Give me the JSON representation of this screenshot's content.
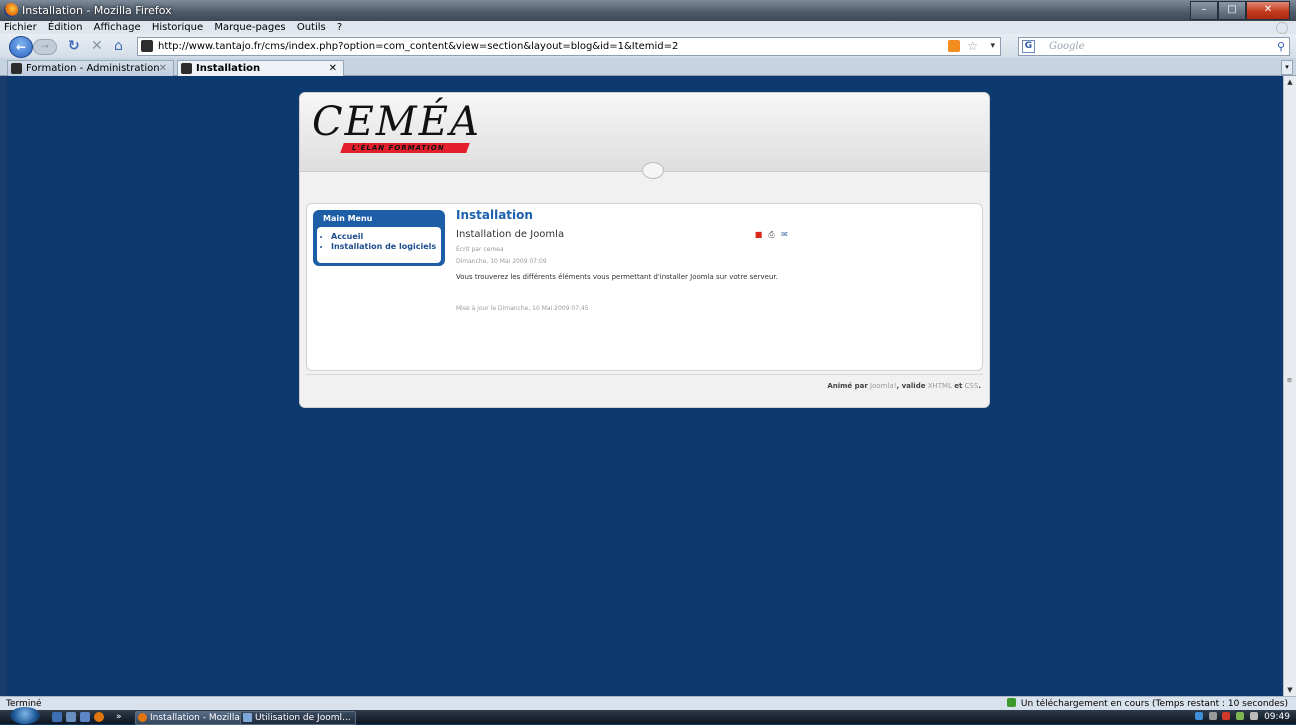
{
  "window": {
    "title": "Installation - Mozilla Firefox"
  },
  "menubar": {
    "items": [
      "Fichier",
      "Édition",
      "Affichage",
      "Historique",
      "Marque-pages",
      "Outils",
      "?"
    ]
  },
  "navbar": {
    "url": "http://www.tantajo.fr/cms/index.php?option=com_content&view=section&layout=blog&id=1&Itemid=2",
    "search_placeholder": "Google"
  },
  "tabs": [
    {
      "label": "Formation - Administration",
      "active": false
    },
    {
      "label": "Installation",
      "active": true
    }
  ],
  "page": {
    "logo_text": "CEMÉA",
    "logo_tagline": "L'ÉLAN FORMATION",
    "menu": {
      "title": "Main Menu",
      "items": [
        "Accueil",
        "Installation de logiciels"
      ]
    },
    "section_title": "Installation",
    "article": {
      "title": "Installation de Joomla",
      "author": "Écrit par cemea",
      "date": "Dimanche, 10 Mai 2009 07:09",
      "body": "Vous trouverez les différents éléments vous permettant d'installer Joomla sur votre serveur.",
      "updated": "Mise à jour le Dimanche, 10 Mai 2009 07:45"
    },
    "footer": {
      "prefix": "Animé par",
      "joomla": "Joomla!",
      "valid": ", valide",
      "xhtml": "XHTML",
      "and": "et",
      "css": "CSS",
      "dot": "."
    }
  },
  "statusbar": {
    "left": "Terminé",
    "right": "Un téléchargement en cours (Temps restant : 10 secondes)"
  },
  "taskbar": {
    "items": [
      "Installation - Mozilla...",
      "Utilisation de Jooml..."
    ],
    "clock": "09:49"
  },
  "colors": {
    "page_bg": "#0d3a6e",
    "accent_blue": "#1c61ad",
    "logo_red": "#e3202b"
  }
}
